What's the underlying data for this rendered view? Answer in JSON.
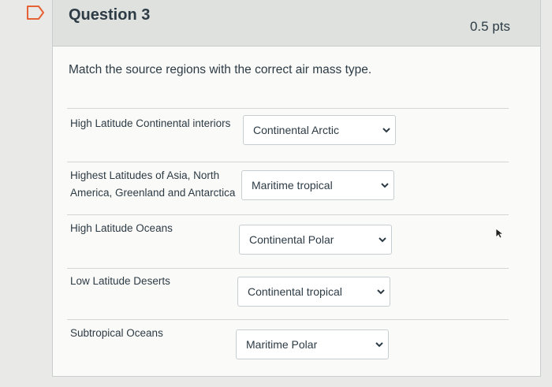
{
  "question": {
    "title": "Question 3",
    "points": "0.5 pts",
    "prompt": "Match the source regions with the correct air mass type."
  },
  "rows": [
    {
      "label": "High Latitude Continental interiors",
      "selected": "Continental Arctic"
    },
    {
      "label": "Highest Latitudes of Asia, North America, Greenland and Antarctica",
      "selected": "Maritime tropical"
    },
    {
      "label": "High Latitude Oceans",
      "selected": "Continental Polar"
    },
    {
      "label": "Low Latitude Deserts",
      "selected": "Continental tropical"
    },
    {
      "label": "Subtropical Oceans",
      "selected": "Maritime Polar"
    }
  ],
  "colors": {
    "header_bg": "#dfe1de",
    "bookmark_accent": "#e66135",
    "text": "#2d3b45"
  },
  "icons": {
    "bookmark": "bookmark-flag-icon",
    "dropdown": "chevron-down-icon",
    "cursor": "mouse-pointer-icon"
  }
}
